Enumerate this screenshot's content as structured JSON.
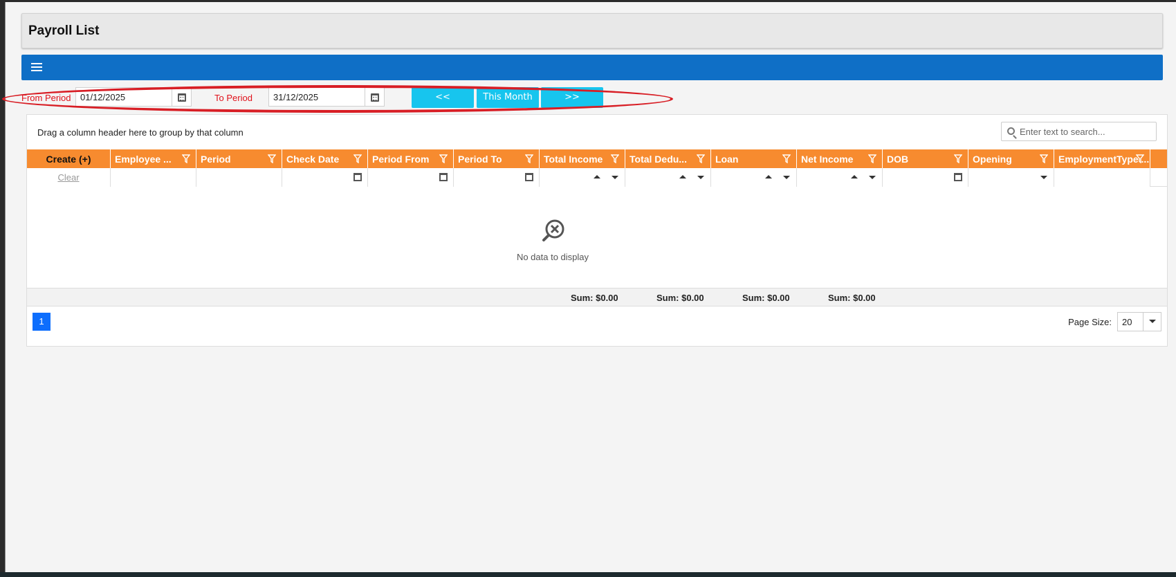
{
  "page": {
    "title": "Payroll List"
  },
  "filters": {
    "from_label": "From Period",
    "from_value": "01/12/2025",
    "to_label": "To Period",
    "to_value": "31/12/2025",
    "prev_label": "<<",
    "this_month_label": "This Month",
    "next_label": ">>"
  },
  "grid": {
    "group_panel_text": "Drag a column header here to group by that column",
    "search_placeholder": "Enter text to search...",
    "columns": [
      "Create (+)",
      "Employee ...",
      "Period",
      "Check Date",
      "Period From",
      "Period To",
      "Total Income",
      "Total Dedu...",
      "Loan",
      "Net Income",
      "DOB",
      "Opening",
      "EmploymentType ..."
    ],
    "clear_label": "Clear",
    "no_data_text": "No data to display",
    "sums": [
      "Sum: $0.00",
      "Sum: $0.00",
      "Sum: $0.00",
      "Sum: $0.00"
    ]
  },
  "pager": {
    "current_page": "1",
    "page_size_label": "Page Size:",
    "page_size_value": "20"
  },
  "colors": {
    "menu_bar": "#0f6fc6",
    "header": "#f78b2f",
    "nav_button": "#17c5ee",
    "highlight": "#d81e25",
    "label_red": "#e0101a"
  }
}
